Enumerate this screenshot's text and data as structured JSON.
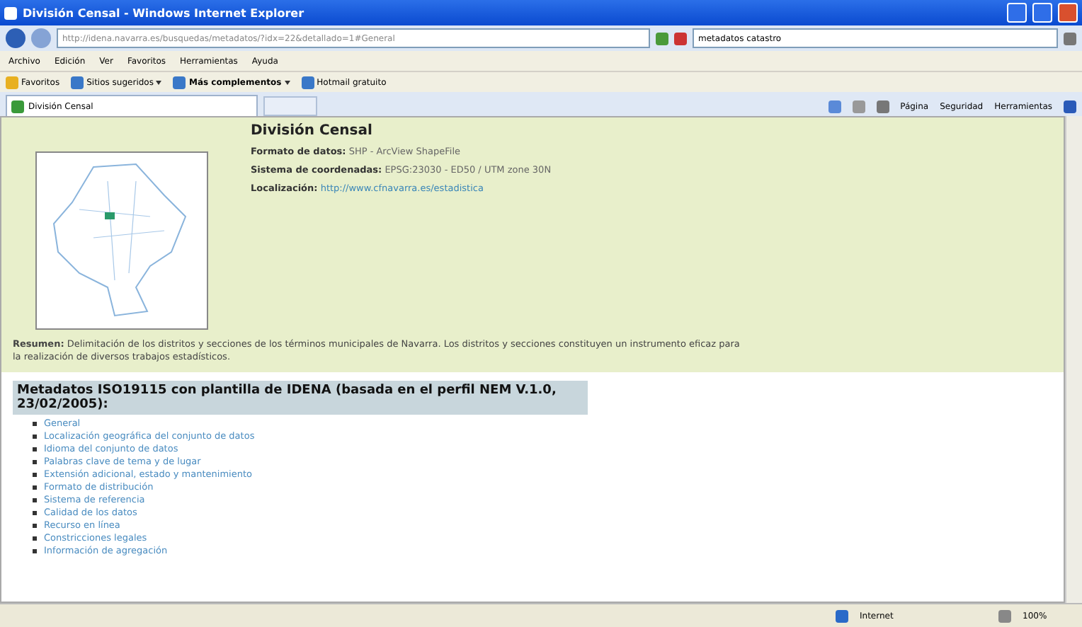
{
  "window": {
    "title": "División Censal - Windows Internet Explorer"
  },
  "address_bar": {
    "url": "http://idena.navarra.es/busquedas/metadatos/?idx=22&detallado=1#General",
    "search_value": "metadatos catastro"
  },
  "menu": [
    "Archivo",
    "Edición",
    "Ver",
    "Favoritos",
    "Herramientas",
    "Ayuda"
  ],
  "favorites_bar": {
    "favorites": "Favoritos",
    "links": [
      {
        "label": "Sitios sugeridos",
        "dropdown": true,
        "bold": false
      },
      {
        "label": "Más complementos",
        "dropdown": true,
        "bold": true
      },
      {
        "label": "Hotmail gratuito",
        "dropdown": false,
        "bold": false
      }
    ]
  },
  "tabs": [
    {
      "label": "División Censal",
      "selected": true
    }
  ],
  "command_bar": [
    "Página",
    "Seguridad",
    "Herramientas"
  ],
  "dataset": {
    "title": "División Censal",
    "fields": [
      {
        "label": "Formato de datos:",
        "value": "SHP - ArcView ShapeFile",
        "kind": "text"
      },
      {
        "label": "Sistema de coordenadas:",
        "value": "EPSG:23030 - ED50 / UTM zone 30N",
        "kind": "text"
      },
      {
        "label": "Localización:",
        "value": "http://www.cfnavarra.es/estadistica",
        "kind": "link"
      }
    ],
    "summary": "**Resumen:** Delimitación de los distritos y secciones de los términos municipales de Navarra. Los distritos y secciones constituyen un instrumento eficaz para la realización de diversos trabajos estadísticos."
  },
  "metadata": {
    "heading": "Metadatos ISO19115 con plantilla de IDENA (basada en el perfil NEM V.1.0, 23/02/2005):",
    "links": [
      "General",
      "Localización geográfica del conjunto de datos",
      "Idioma del conjunto de datos",
      "Palabras clave de tema y de lugar",
      "Extensión adicional, estado y mantenimiento",
      "Formato de distribución",
      "Sistema de referencia",
      "Calidad de los datos",
      "Recurso en línea",
      "Constricciones legales",
      "Información de agregación"
    ]
  },
  "status_bar": {
    "zone": "Internet",
    "zoom": "100%"
  }
}
